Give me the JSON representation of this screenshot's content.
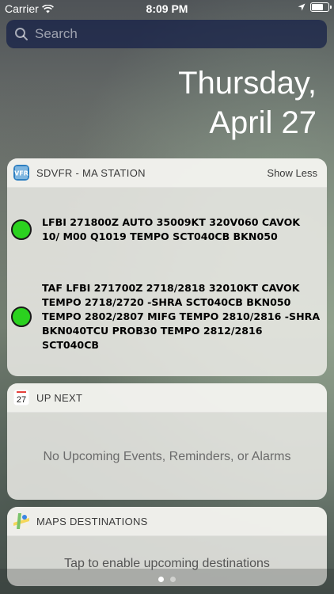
{
  "status_bar": {
    "carrier": "Carrier",
    "time": "8:09 PM",
    "battery_level": 0.8
  },
  "search": {
    "placeholder": "Search"
  },
  "date": {
    "line1": "Thursday,",
    "line2": "April 27"
  },
  "widgets": [
    {
      "title": "SDVFR - MA STATION",
      "action": "Show Less",
      "entries": [
        {
          "text": "LFBI 271800Z AUTO 35009KT 320V060 CAVOK 10/ M00 Q1019 TEMPO SCT040CB BKN050",
          "status_color": "#2bd21f"
        },
        {
          "text": "TAF LFBI 271700Z 2718/2818 32010KT CAVOK TEMPO 2718/2720 -SHRA SCT040CB BKN050 TEMPO 2802/2807 MIFG TEMPO 2810/2816 -SHRA BKN040TCU PROB30 TEMPO 2812/2816 SCT040CB",
          "status_color": "#2bd21f"
        }
      ]
    },
    {
      "title": "UP NEXT",
      "calendar_day": "27",
      "message": "No Upcoming Events, Reminders, or Alarms"
    },
    {
      "title": "MAPS DESTINATIONS",
      "message": "Tap to enable upcoming destinations"
    }
  ],
  "pager": {
    "pages": 2,
    "active": 1
  }
}
